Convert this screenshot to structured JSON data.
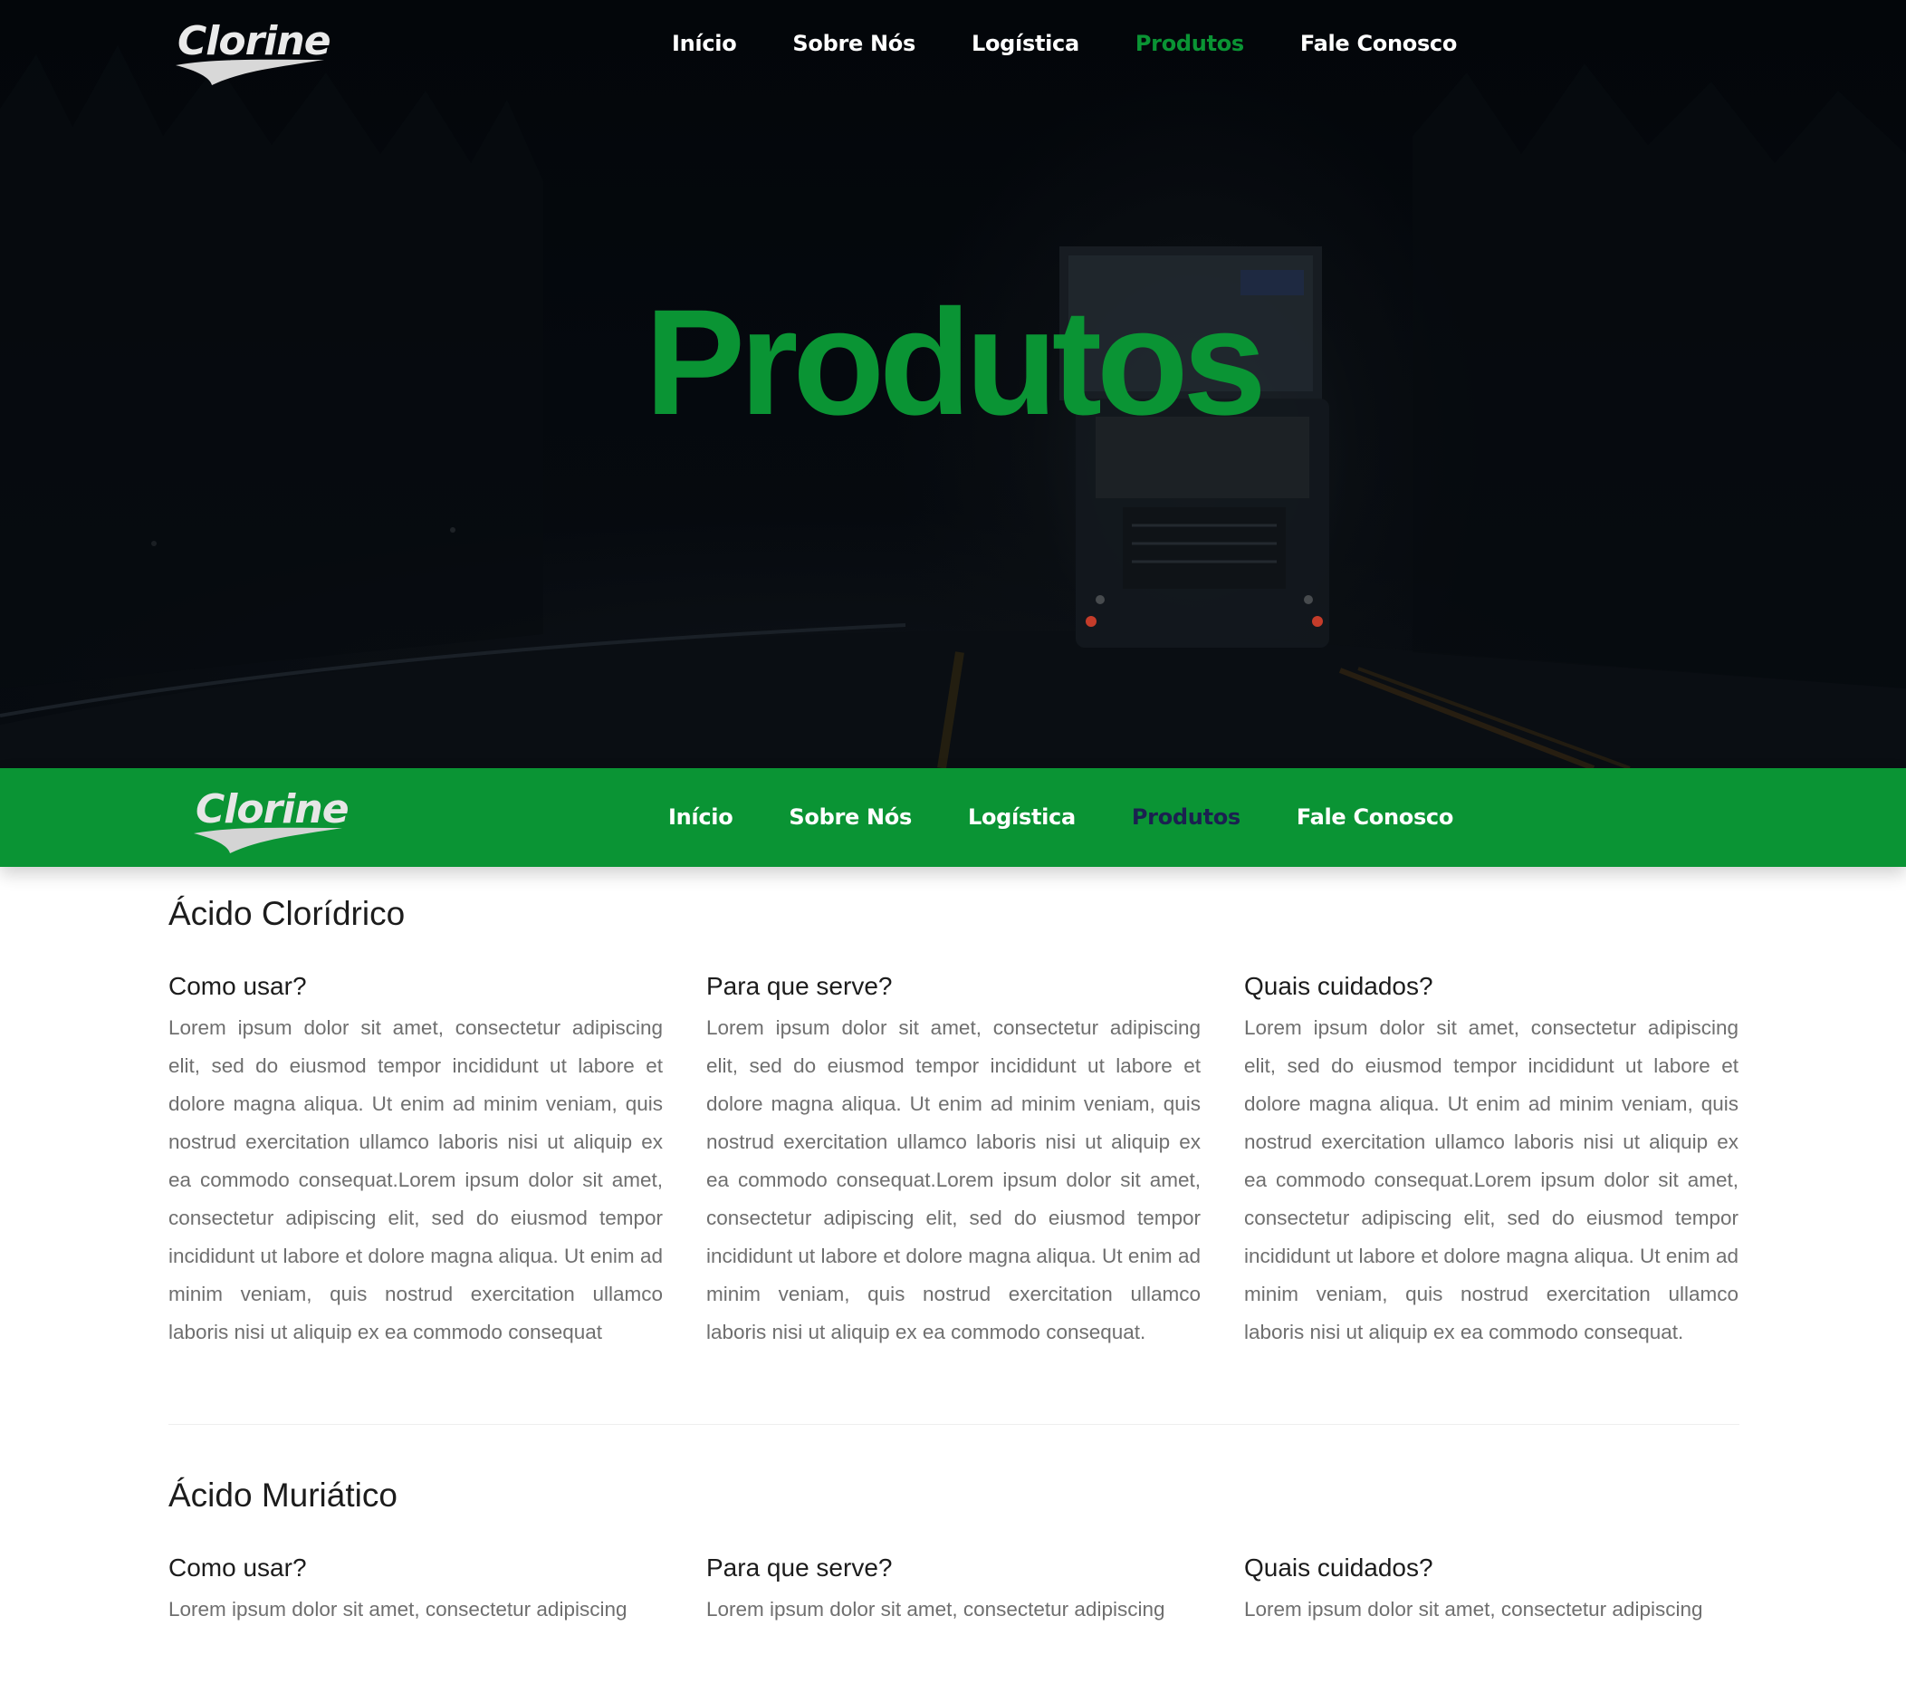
{
  "brand": {
    "logo_text": "Clorine"
  },
  "nav": {
    "items": [
      {
        "label": "Início",
        "active": false
      },
      {
        "label": "Sobre Nós",
        "active": false
      },
      {
        "label": "Logística",
        "active": false
      },
      {
        "label": "Produtos",
        "active": true
      },
      {
        "label": "Fale Conosco",
        "active": false
      }
    ]
  },
  "hero": {
    "title": "Produtos"
  },
  "colors": {
    "brand_green": "#0a9434",
    "active_dark": "#1b2150",
    "hero_bg": "#05090e"
  },
  "products": [
    {
      "title": "Ácido Clorídrico",
      "columns": [
        {
          "heading": "Como usar?",
          "text": "Lorem ipsum dolor sit amet, consectetur adipiscing elit, sed do eiusmod tempor incididunt ut labore et dolore magna aliqua. Ut enim ad minim veniam, quis nostrud exercitation ullamco laboris nisi ut aliquip ex ea commodo consequat.Lorem ipsum dolor sit amet, consectetur adipiscing elit, sed do eiusmod tempor incididunt ut labore et dolore magna aliqua. Ut enim ad minim veniam, quis nostrud exercitation ullamco laboris nisi ut aliquip ex ea commodo consequat"
        },
        {
          "heading": "Para que serve?",
          "text": "Lorem ipsum dolor sit amet, consectetur adipiscing elit, sed do eiusmod tempor incididunt ut labore et dolore magna aliqua. Ut enim ad minim veniam, quis nostrud exercitation ullamco laboris nisi ut aliquip ex ea commodo consequat.Lorem ipsum dolor sit amet, consectetur adipiscing elit, sed do eiusmod tempor incididunt ut labore et dolore magna aliqua. Ut enim ad minim veniam, quis nostrud exercitation ullamco laboris nisi ut aliquip ex ea commodo consequat."
        },
        {
          "heading": "Quais cuidados?",
          "text": "Lorem ipsum dolor sit amet, consectetur adipiscing elit, sed do eiusmod tempor incididunt ut labore et dolore magna aliqua. Ut enim ad minim veniam, quis nostrud exercitation ullamco laboris nisi ut aliquip ex ea commodo consequat.Lorem ipsum dolor sit amet, consectetur adipiscing elit, sed do eiusmod tempor incididunt ut labore et dolore magna aliqua. Ut enim ad minim veniam, quis nostrud exercitation ullamco laboris nisi ut aliquip ex ea commodo consequat."
        }
      ]
    },
    {
      "title": "Ácido Muriático",
      "columns": [
        {
          "heading": "Como usar?",
          "text": "Lorem ipsum dolor sit amet, consectetur adipiscing"
        },
        {
          "heading": "Para que serve?",
          "text": "Lorem ipsum dolor sit amet, consectetur adipiscing"
        },
        {
          "heading": "Quais cuidados?",
          "text": "Lorem ipsum dolor sit amet, consectetur adipiscing"
        }
      ]
    }
  ]
}
